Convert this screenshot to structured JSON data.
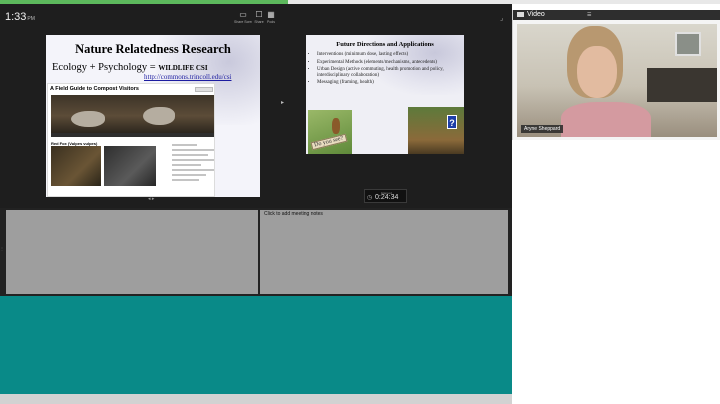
{
  "topbar": {
    "time": "1:33",
    "ampm": "PM",
    "progress_percent": 40,
    "buttons": [
      {
        "label": "Share Screen",
        "icon": "screen-share-icon"
      },
      {
        "label": "Share",
        "icon": "share-icon"
      },
      {
        "label": "Pods",
        "icon": "pods-icon"
      }
    ]
  },
  "slide1": {
    "title": "Nature Relatedness Research",
    "subtitle": "Ecology + Psychology =",
    "subtitle_highlight": "WILDLIFE CSI",
    "link": "http://commons.trincoll.edu/csi",
    "website": {
      "title": "A Field Guide to Compost Visitors",
      "heading": "Red Fox (Vulpes vulpes)"
    }
  },
  "slide2": {
    "title": "Future Directions and Applications",
    "bullets": [
      "Interventions (minimum dose, lasting effects)",
      "Experimental Methods (elements/mechanisms, antecedents)",
      "Urban Design (active commuting, health promotion and policy, interdisciplinary collaboration)",
      "Messaging (framing, health)"
    ],
    "image_sign": "Do you see?"
  },
  "timer": {
    "label": "Elapsed",
    "value": "0:24:34"
  },
  "notes": {
    "placeholder": "Click to add meeting notes"
  },
  "video_pod": {
    "title": "Video",
    "menu": "☰",
    "participant_name": "Aryne Sheppard"
  },
  "colors": {
    "accent_progress": "#5cb85c",
    "teal_area": "#098a88",
    "pod_gray": "#9e9e9e",
    "stage_dark": "#1e1e1e"
  }
}
